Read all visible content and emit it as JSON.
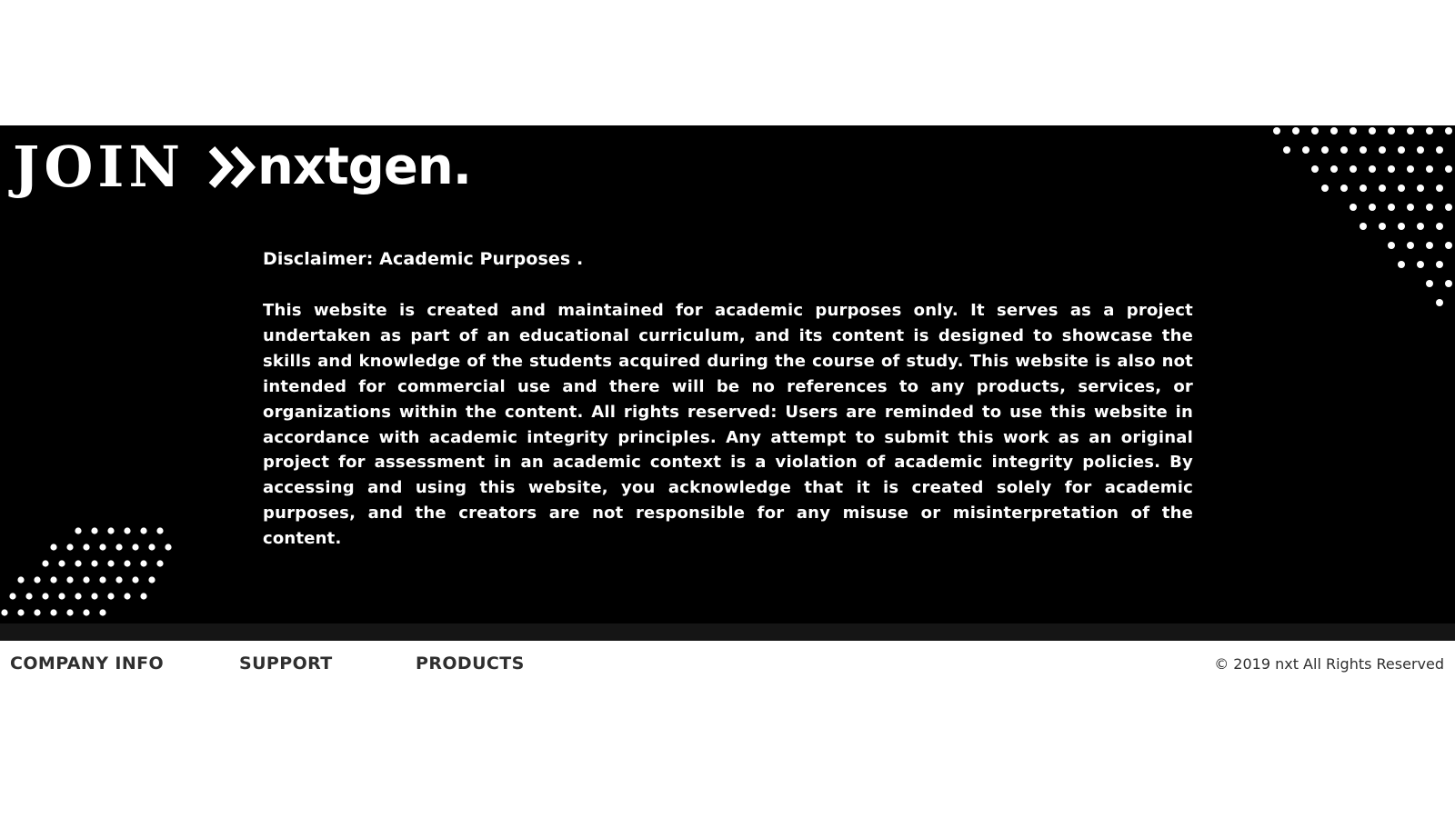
{
  "header": {
    "brand": {
      "join_text": "JOIN",
      "name_text": "nxtgen.",
      "arrow_icon": "double-chevron-right-icon"
    }
  },
  "disclaimer": {
    "title": "Disclaimer: Academic Purposes .",
    "body": "This website is created and maintained for academic purposes only. It serves as a project undertaken as part of an educational curriculum, and its content is designed to showcase the skills and knowledge of the students acquired during the course of study. This website is also not intended for commercial use and there will be no references to any products, services, or organizations within the content. All rights reserved: Users are reminded to use this website in accordance with academic integrity principles. Any attempt to submit this work as an original project for assessment in an academic context is a violation of academic integrity policies. By accessing and using this website, you acknowledge that it is created solely for academic purposes, and the creators are not responsible for any misuse or misinterpretation of the content."
  },
  "footer": {
    "links": [
      {
        "label": "COMPANY INFO"
      },
      {
        "label": "SUPPORT"
      },
      {
        "label": "PRODUCTS"
      }
    ],
    "copyright": "© 2019 nxt All Rights Reserved"
  },
  "colors": {
    "hero_background": "#000000",
    "hero_text": "#ffffff",
    "footer_strip": "#151515",
    "footer_text": "#2f2f2f",
    "page_background": "#ffffff"
  }
}
